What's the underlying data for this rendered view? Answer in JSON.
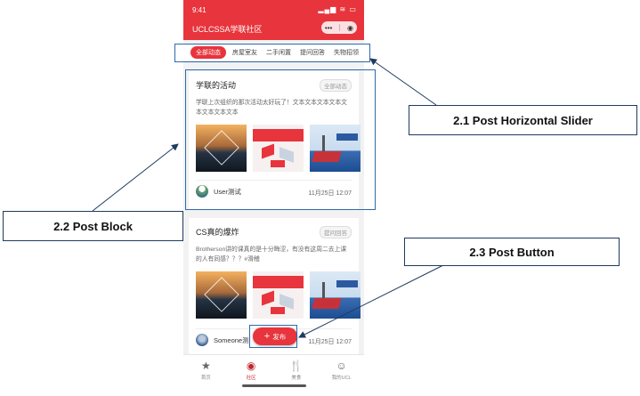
{
  "status": {
    "time": "9:41",
    "icons": "▂▄▆ ≋ ▭"
  },
  "app": {
    "title": "UCLCSSA学联社区",
    "capsule_menu": "•••",
    "capsule_close": "◉"
  },
  "tabs": [
    "全部动态",
    "房屋室友",
    "二手闲置",
    "提问回答",
    "失物招领"
  ],
  "posts": [
    {
      "title": "学联的活动",
      "badge": "全部动态",
      "text": "学联上次组织的那次活动太好玩了！文本文本文本文本文本文本文本文本",
      "user": "User测试",
      "date": "11月25日 12:07"
    },
    {
      "title": "CS真的爆炸",
      "badge": "提问回答",
      "text": "Brotherson讲的课真的是十分晦涩，有没有这周二去上课的人有同感？？？#滑稽",
      "user": "Someone测",
      "date": "11月25日 12:07"
    }
  ],
  "post_button": {
    "plus": "+",
    "label": "发布"
  },
  "nav": [
    {
      "icon": "star-icon",
      "glyph": "★",
      "label": "首页"
    },
    {
      "icon": "compass-icon",
      "glyph": "◉",
      "label": "社区"
    },
    {
      "icon": "fork-knife-icon",
      "glyph": "🍴",
      "label": "美食"
    },
    {
      "icon": "user-icon",
      "glyph": "☺",
      "label": "我的UCL"
    }
  ],
  "callouts": {
    "slider": "2.1 Post Horizontal Slider",
    "block": "2.2 Post Block",
    "button": "2.3 Post Button"
  },
  "colors": {
    "brand": "#e8343c",
    "annotation": "#1f3a5f"
  }
}
